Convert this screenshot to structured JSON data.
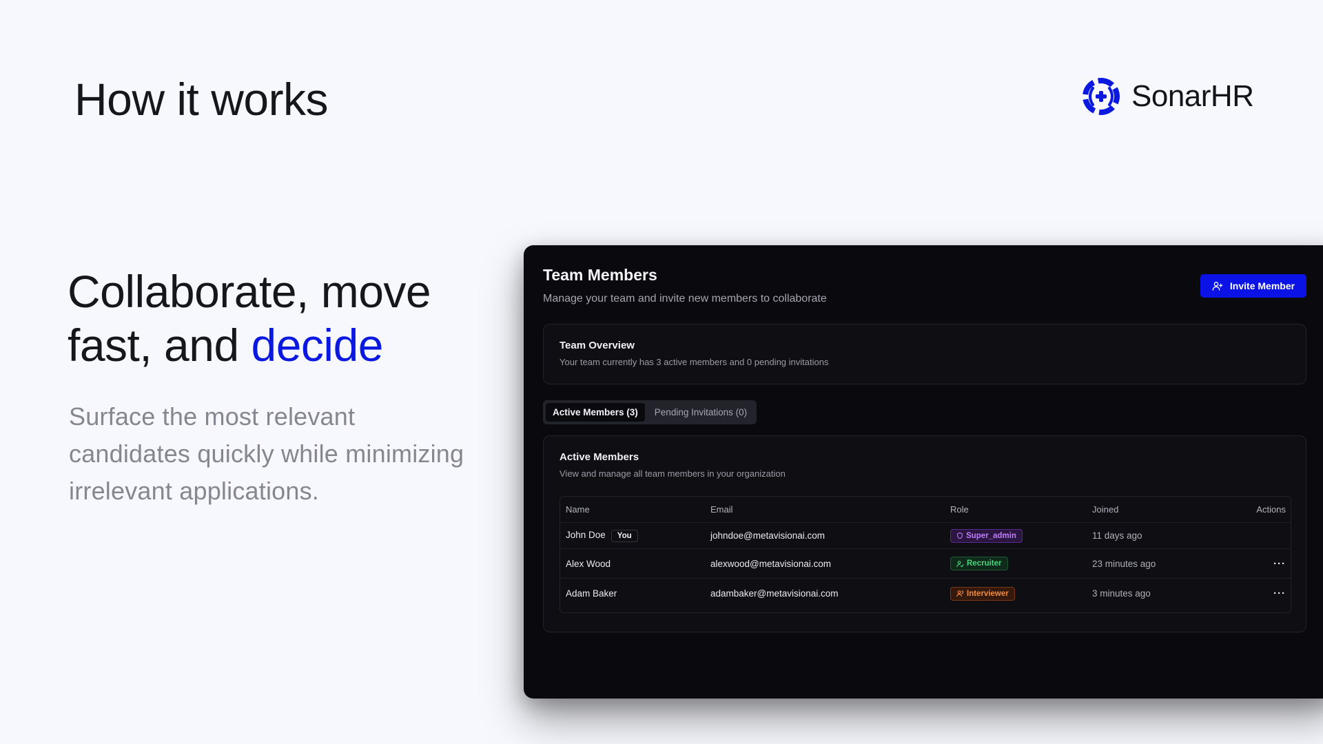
{
  "page": {
    "title": "How it works",
    "headline_part1": "Collaborate, move fast, and ",
    "headline_accent": "decide",
    "subcopy": "Surface the most relevant candidates quickly while minimizing irrelevant applications."
  },
  "brand": {
    "name": "SonarHR",
    "accent_color": "#0a18e0"
  },
  "app": {
    "title": "Team Members",
    "subtitle": "Manage your team and invite new members to collaborate",
    "invite_label": "Invite Member",
    "overview": {
      "title": "Team Overview",
      "text": "Your team currently has 3 active members and 0 pending invitations"
    },
    "tabs": [
      {
        "label": "Active Members (3)",
        "active": true
      },
      {
        "label": "Pending Invitations (0)",
        "active": false
      }
    ],
    "members_card": {
      "title": "Active Members",
      "subtitle": "View and manage all team members in your organization"
    },
    "table": {
      "headers": {
        "name": "Name",
        "email": "Email",
        "role": "Role",
        "joined": "Joined",
        "actions": "Actions"
      },
      "rows": [
        {
          "name": "John Doe",
          "you_badge": "You",
          "email": "johndoe@metavisionai.com",
          "role": "Super_admin",
          "joined": "11 days ago",
          "actions": ""
        },
        {
          "name": "Alex Wood",
          "you_badge": "",
          "email": "alexwood@metavisionai.com",
          "role": "Recruiter",
          "joined": "23 minutes ago",
          "actions": "···"
        },
        {
          "name": "Adam Baker",
          "you_badge": "",
          "email": "adambaker@metavisionai.com",
          "role": "Interviewer",
          "joined": "3 minutes ago",
          "actions": "···"
        }
      ]
    }
  },
  "colors": {
    "primary_button": "#0a12e6",
    "super_admin": "#c07dfa",
    "recruiter": "#4ad47d",
    "interviewer": "#f38a3a"
  },
  "icons": {
    "logo": "sonar-logo-icon",
    "invite": "user-plus-icon",
    "super_admin": "shield-icon",
    "recruiter": "user-check-icon",
    "interviewer": "users-icon",
    "more": "more-horizontal-icon"
  }
}
